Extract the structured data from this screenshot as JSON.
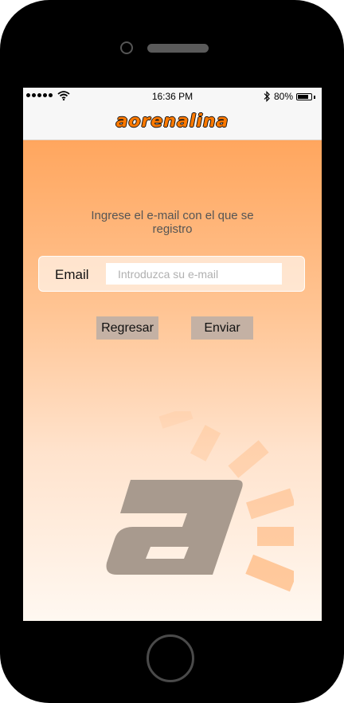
{
  "status_bar": {
    "time": "16:36 PM",
    "battery_text": "80%",
    "battery_level": 0.8
  },
  "header": {
    "logo_text": "aorenalina"
  },
  "form": {
    "instruction": "Ingrese el e-mail  con el que se registro",
    "email_label": "Email",
    "email_placeholder": "Introduzca su e-mail",
    "email_value": ""
  },
  "buttons": {
    "back_label": "Regresar",
    "send_label": "Enviar"
  },
  "colors": {
    "brand_orange": "#ff7a00",
    "gradient_top": "#ffa65e",
    "button_bg": "#c4b1a4",
    "watermark_letter": "#a89a8e"
  },
  "icons": [
    "signal-dots-icon",
    "wifi-icon",
    "bluetooth-icon",
    "battery-icon",
    "adrenalina-logo-watermark"
  ]
}
